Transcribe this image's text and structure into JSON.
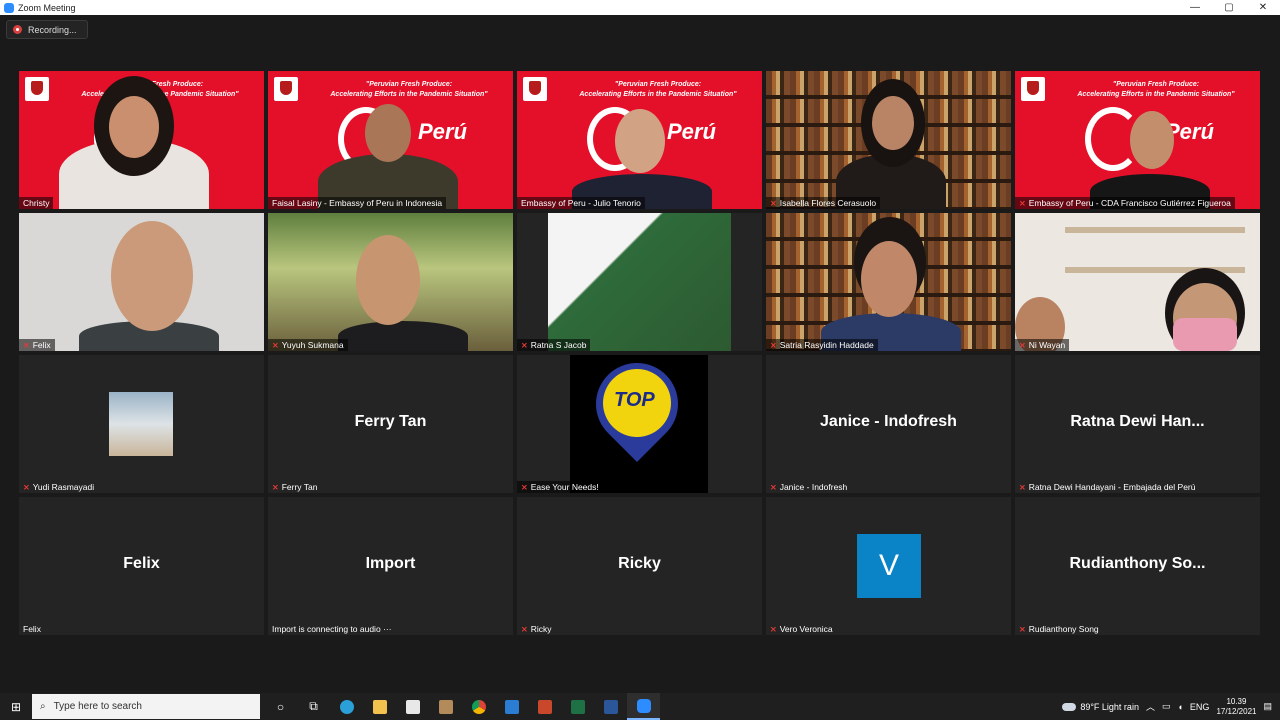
{
  "window": {
    "title": "Zoom Meeting",
    "minimize_glyph": "—",
    "maximize_glyph": "▢",
    "close_glyph": "✕"
  },
  "recording": {
    "label": "Recording..."
  },
  "banner": {
    "line1": "\"Peruvian Fresh Produce:",
    "line2": "Accelerating Efforts in the Pandemic Situation\"",
    "brand": "Perú"
  },
  "tiles": [
    {
      "name": "Christy",
      "muted": false
    },
    {
      "name": "Faisal Lasiny - Embassy of Peru in Indonesia",
      "muted": false
    },
    {
      "name": "Embassy of Peru - Julio Tenorio",
      "muted": false
    },
    {
      "name": "Isabella Flores Cerasuolo",
      "muted": true
    },
    {
      "name": "Embassy of Peru - CDA Francisco Gutiérrez Figueroa",
      "muted": true
    },
    {
      "name": "Felix",
      "muted": true
    },
    {
      "name": "Yuyuh Sukmana",
      "muted": true
    },
    {
      "name": "Ratna S Jacob",
      "muted": true
    },
    {
      "name": "Satria Rasyidin Haddade",
      "muted": true
    },
    {
      "name": "Ni Wayan",
      "muted": true
    },
    {
      "name": "Yudi Rasmayadi",
      "muted": true
    },
    {
      "name": "Ferry Tan",
      "big": "Ferry Tan",
      "muted": true
    },
    {
      "name": "Ease Your Needs!",
      "muted": true,
      "logo_text": "TOP"
    },
    {
      "name": "Janice - Indofresh",
      "big": "Janice - Indofresh",
      "muted": true
    },
    {
      "name": "Ratna Dewi Handayani - Embajada del Perú",
      "big": "Ratna  Dewi  Han...",
      "muted": true
    },
    {
      "name": "Felix",
      "big": "Felix",
      "muted": false
    },
    {
      "name": "Import is connecting to audio ···",
      "big": "Import",
      "muted": false
    },
    {
      "name": "Ricky",
      "big": "Ricky",
      "muted": true
    },
    {
      "name": "Vero Veronica",
      "avatar_letter": "V",
      "muted": true
    },
    {
      "name": "Rudianthony Song",
      "big": "Rudianthony  So...",
      "muted": true
    }
  ],
  "taskbar": {
    "search_placeholder": "Type here to search",
    "apps": [
      "task-view",
      "edge",
      "file-explorer",
      "store",
      "media",
      "chrome",
      "mail",
      "powerpoint",
      "excel",
      "word",
      "zoom"
    ],
    "weather": "89°F  Light rain",
    "lang": "ENG",
    "time": "10.39",
    "date": "17/12/2021"
  }
}
